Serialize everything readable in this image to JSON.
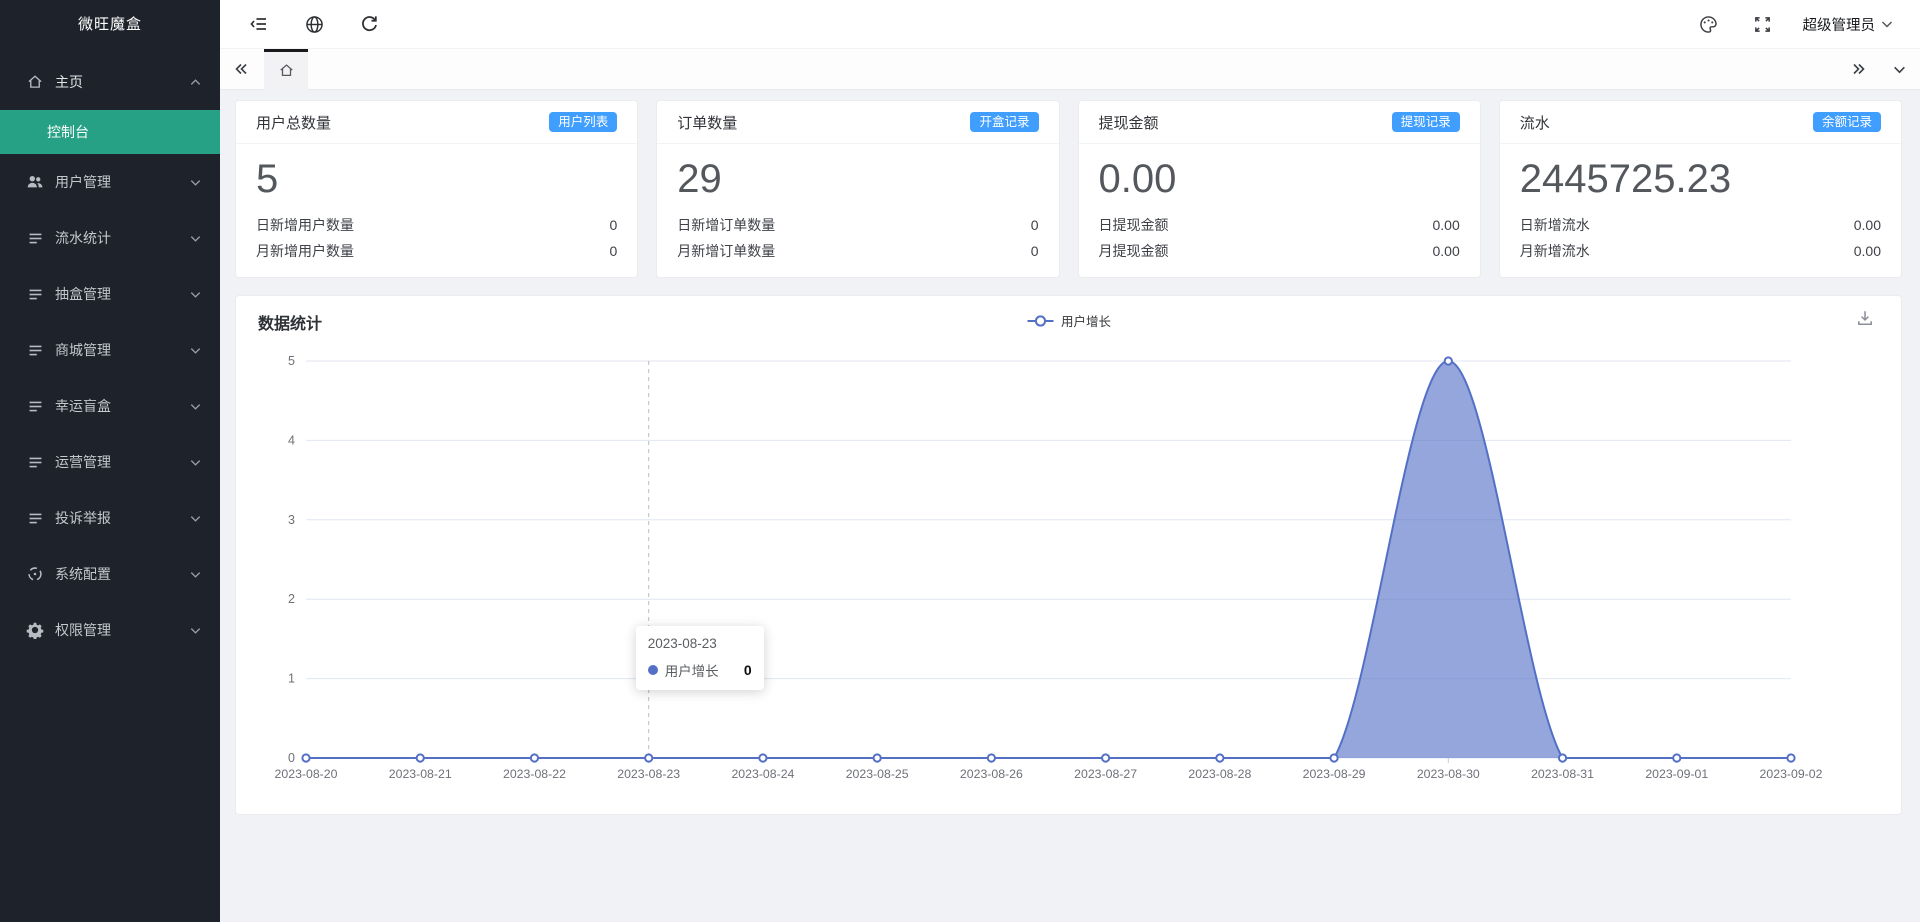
{
  "app": {
    "logo": "微旺魔盒"
  },
  "sidebar": {
    "items": [
      {
        "label": "主页",
        "icon": "home-icon",
        "chevron": "up",
        "type": "group",
        "expanded": true
      },
      {
        "label": "控制台",
        "type": "sub",
        "active": true
      },
      {
        "label": "用户管理",
        "icon": "users-icon",
        "chevron": "down",
        "type": "group"
      },
      {
        "label": "流水统计",
        "icon": "list-icon",
        "chevron": "down",
        "type": "group"
      },
      {
        "label": "抽盒管理",
        "icon": "list-icon",
        "chevron": "down",
        "type": "group"
      },
      {
        "label": "商城管理",
        "icon": "list-icon",
        "chevron": "down",
        "type": "group"
      },
      {
        "label": "幸运盲盒",
        "icon": "list-icon",
        "chevron": "down",
        "type": "group"
      },
      {
        "label": "运营管理",
        "icon": "list-icon",
        "chevron": "down",
        "type": "group"
      },
      {
        "label": "投诉举报",
        "icon": "list-icon",
        "chevron": "down",
        "type": "group"
      },
      {
        "label": "系统配置",
        "icon": "config-icon",
        "chevron": "down",
        "type": "group"
      },
      {
        "label": "权限管理",
        "icon": "gear-icon",
        "chevron": "down",
        "type": "group"
      }
    ]
  },
  "topbar": {
    "left_icons": [
      "menu-collapse-icon",
      "globe-icon",
      "refresh-icon"
    ],
    "right_icons": [
      "palette-icon",
      "fullscreen-icon"
    ],
    "user_label": "超级管理员"
  },
  "tabbar": {
    "left_icon": "double-chevron-left-icon",
    "tabs": [
      {
        "icon": "home-icon",
        "active": true
      }
    ],
    "right_icons": [
      "double-chevron-right-icon",
      "chevron-down-icon"
    ]
  },
  "stat_cards": [
    {
      "title": "用户总数量",
      "badge": "用户列表",
      "value": "5",
      "rows": [
        {
          "label": "日新增用户数量",
          "value": "0"
        },
        {
          "label": "月新增用户数量",
          "value": "0"
        }
      ]
    },
    {
      "title": "订单数量",
      "badge": "开盒记录",
      "value": "29",
      "rows": [
        {
          "label": "日新增订单数量",
          "value": "0"
        },
        {
          "label": "月新增订单数量",
          "value": "0"
        }
      ]
    },
    {
      "title": "提现金额",
      "badge": "提现记录",
      "value": "0.00",
      "rows": [
        {
          "label": "日提现金额",
          "value": "0.00"
        },
        {
          "label": "月提现金额",
          "value": "0.00"
        }
      ]
    },
    {
      "title": "流水",
      "badge": "余额记录",
      "value": "2445725.23",
      "rows": [
        {
          "label": "日新增流水",
          "value": "0.00"
        },
        {
          "label": "月新增流水",
          "value": "0.00"
        }
      ]
    }
  ],
  "chart": {
    "title": "数据统计"
  },
  "chart_data": {
    "type": "area",
    "title": "数据统计",
    "x": [
      "2023-08-20",
      "2023-08-21",
      "2023-08-22",
      "2023-08-23",
      "2023-08-24",
      "2023-08-25",
      "2023-08-26",
      "2023-08-27",
      "2023-08-28",
      "2023-08-29",
      "2023-08-30",
      "2023-08-31",
      "2023-09-01",
      "2023-09-02"
    ],
    "series": [
      {
        "name": "用户增长",
        "values": [
          0,
          0,
          0,
          0,
          0,
          0,
          0,
          0,
          0,
          0,
          5,
          0,
          0,
          0
        ],
        "color": "#5470c6"
      }
    ],
    "ylim": [
      0,
      5
    ],
    "yticks": [
      "0",
      "1",
      "2",
      "3",
      "4",
      "5"
    ],
    "grid": true,
    "legend_position": "top-center",
    "smooth": true,
    "tooltip": {
      "date": "2023-08-23",
      "series": "用户增长",
      "value": "0",
      "x_index": 3
    }
  },
  "colors": {
    "sidebar_bg": "#1e222a",
    "accent_active": "#27a185",
    "badge_blue": "#409eff",
    "chart_line": "#5470c6",
    "grid_line": "#e0e6f1",
    "axis_text": "#6e7079"
  }
}
